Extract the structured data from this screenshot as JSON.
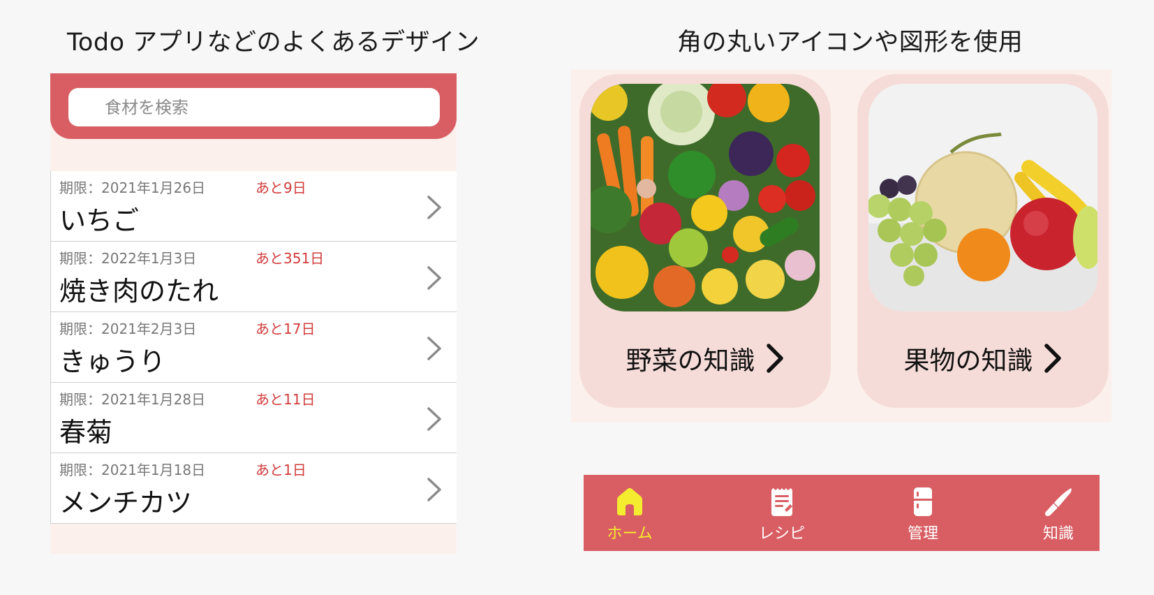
{
  "headings": {
    "left": "Todo アプリなどのよくあるデザイン",
    "right": "角の丸いアイコンや図形を使用"
  },
  "search": {
    "placeholder": "食材を検索"
  },
  "todo_items": [
    {
      "deadline": "期限：2021年1月26日",
      "remaining": "あと9日",
      "name": "いちご"
    },
    {
      "deadline": "期限：2022年1月3日",
      "remaining": "あと351日",
      "name": "焼き肉のたれ"
    },
    {
      "deadline": "期限：2021年2月3日",
      "remaining": "あと17日",
      "name": "きゅうり"
    },
    {
      "deadline": "期限：2021年1月28日",
      "remaining": "あと11日",
      "name": "春菊"
    },
    {
      "deadline": "期限：2021年1月18日",
      "remaining": "あと1日",
      "name": "メンチカツ"
    }
  ],
  "cards": {
    "vegetables": {
      "label": "野菜の知識"
    },
    "fruits": {
      "label": "果物の知識"
    }
  },
  "nav": {
    "home": "ホーム",
    "recipe": "レシピ",
    "manage": "管理",
    "knowledge": "知識",
    "active": "home"
  },
  "colors": {
    "accent": "#d95e63",
    "panel_bg": "#fbf0ec",
    "card_bg": "#f6dcd8",
    "remaining_text": "#d23b3b",
    "active_nav": "#f4ec2f"
  }
}
